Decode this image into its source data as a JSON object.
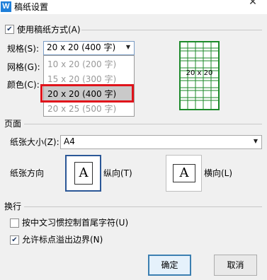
{
  "window": {
    "title": "稿纸设置",
    "app_icon_letter": "W",
    "close_glyph": "✕"
  },
  "use_manuscript": {
    "label": "使用稿纸方式(A)",
    "checked": true
  },
  "spec": {
    "label": "规格(S):",
    "value": "20 x 20 (400 字)",
    "options": [
      {
        "text": "10 x 20 (200 字)",
        "state": "disabled"
      },
      {
        "text": "15 x 20 (300 字)",
        "state": "disabled"
      },
      {
        "text": "20 x 20 (400 字)",
        "state": "selected"
      },
      {
        "text": "20 x 25 (500 字)",
        "state": "disabled"
      }
    ]
  },
  "grid_label": "网格(G):",
  "color_label": "颜色(C):",
  "preview": {
    "caption": "20 x 20",
    "color": "#1c8a2a"
  },
  "page_section": {
    "title": "页面",
    "paper_size_label": "纸张大小(Z):",
    "paper_size_value": "A4",
    "orientation_label": "纸张方向",
    "portrait_label": "纵向(T)",
    "landscape_label": "横向(L)",
    "page_glyph": "A"
  },
  "wrap_section": {
    "title": "换行",
    "option1": {
      "label": "按中文习惯控制首尾字符(U)",
      "checked": false
    },
    "option2": {
      "label": "允许标点溢出边界(N)",
      "checked": true
    }
  },
  "buttons": {
    "ok": "确定",
    "cancel": "取消"
  },
  "colors": {
    "highlight": "#e0131b",
    "accent": "#2b5797"
  }
}
